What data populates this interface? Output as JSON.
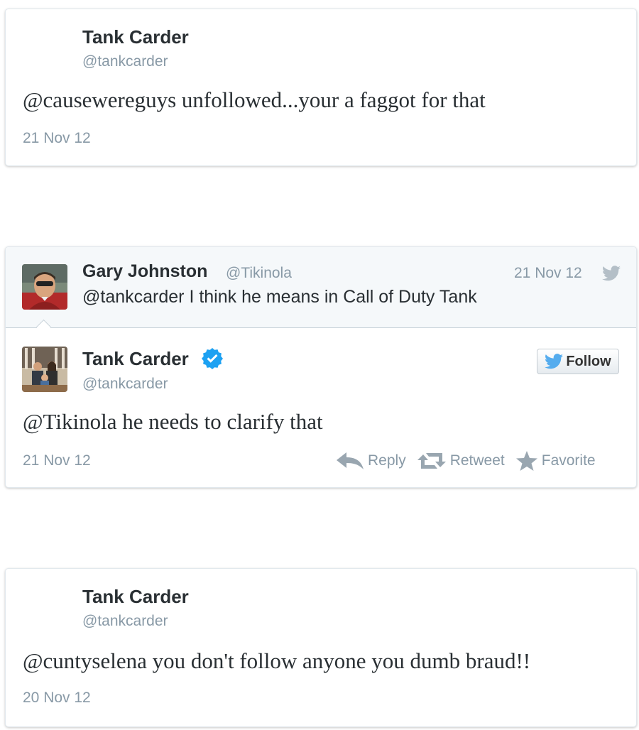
{
  "tweets": [
    {
      "name": "Tank Carder",
      "handle": "@tankcarder",
      "text": "@causewereguys unfollowed...your a faggot for that",
      "date": "21 Nov 12"
    },
    {
      "in_reply_to": {
        "name": "Gary Johnston",
        "handle": "@Tikinola",
        "date": "21 Nov 12",
        "text": "@tankcarder I think he means in Call of Duty Tank"
      },
      "name": "Tank Carder",
      "handle": "@tankcarder",
      "verified": true,
      "follow_label": "Follow",
      "text": "@Tikinola he needs to clarify that",
      "date": "21 Nov 12",
      "actions": {
        "reply": "Reply",
        "retweet": "Retweet",
        "favorite": "Favorite"
      }
    },
    {
      "name": "Tank Carder",
      "handle": "@tankcarder",
      "text": "@cuntyselena you don't follow anyone you dumb braud!!",
      "date": "20 Nov 12"
    }
  ],
  "colors": {
    "twitter_blue": "#55acee",
    "verified_blue": "#1da1f2",
    "muted_text": "#8899a6",
    "body_text": "#292f33",
    "action_grey": "#99a6b0"
  },
  "icons": {
    "bird": "twitter-bird-icon",
    "verified": "verified-badge-icon",
    "reply": "reply-arrow-icon",
    "retweet": "retweet-icon",
    "favorite": "star-icon"
  }
}
